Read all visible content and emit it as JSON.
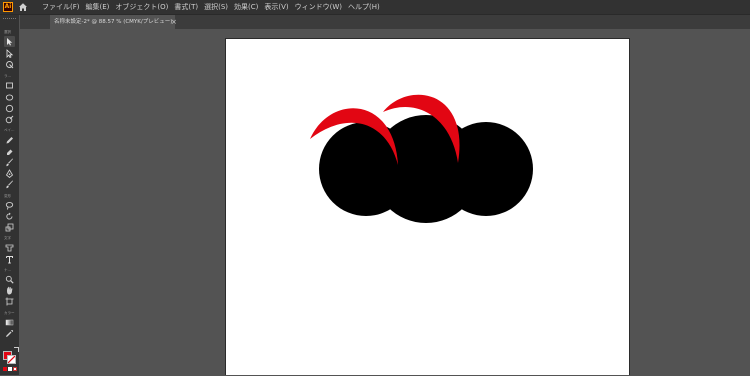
{
  "app": {
    "logo_text": "Ai"
  },
  "menu": [
    "ファイル(F)",
    "編集(E)",
    "オブジェクト(O)",
    "書式(T)",
    "選択(S)",
    "効果(C)",
    "表示(V)",
    "ウィンドウ(W)",
    "ヘルプ(H)"
  ],
  "tab": {
    "label": "名称未設定-2* @ 88.57 % (CMYK/プレビュー)",
    "close": "×"
  },
  "toolbar": {
    "labels": {
      "select": "選択",
      "draw": "ラ…",
      "brush": "ペイ…",
      "modify": "変形",
      "type": "文字",
      "nav": "ナ…",
      "color": "カラー"
    }
  },
  "colors": {
    "fill": "#000000",
    "accent_red": "#e20613",
    "stroke": "#e20613"
  }
}
